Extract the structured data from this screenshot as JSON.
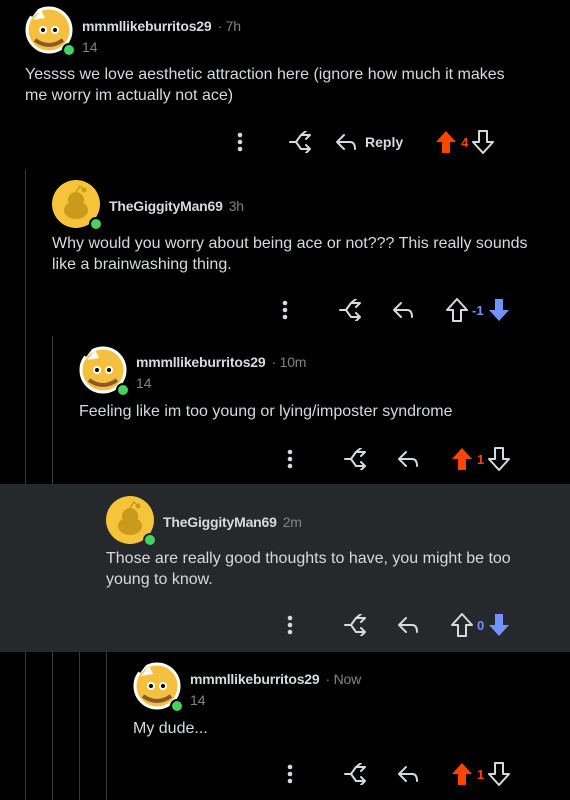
{
  "comments": [
    {
      "username": "mmmllikeburritos29",
      "time": "· 7h",
      "flair": "14",
      "body": "Yessss we love aesthetic attraction here (ignore how much it makes me worry im actually not ace)",
      "reply_label": "Reply",
      "score": "4",
      "vote_state": "up",
      "avatar_style": "burrito"
    },
    {
      "username": "TheGiggityMan69",
      "time": "3h",
      "body": "Why would you worry about being ace or not??? This really sounds like a brainwashing thing.",
      "score": "-1",
      "vote_state": "down",
      "avatar_style": "snoo-yellow"
    },
    {
      "username": "mmmllikeburritos29",
      "time": "· 10m",
      "flair": "14",
      "body": "Feeling like im too young or lying/imposter syndrome",
      "score": "1",
      "vote_state": "up",
      "avatar_style": "burrito"
    },
    {
      "username": "TheGiggityMan69",
      "time": "2m",
      "body": "Those are really good thoughts to have, you might be too young to know.",
      "score": "0",
      "vote_state": "down",
      "avatar_style": "snoo-yellow"
    },
    {
      "username": "mmmllikeburritos29",
      "time": "· Now",
      "flair": "14",
      "body": "My dude...",
      "score": "1",
      "vote_state": "up",
      "avatar_style": "burrito"
    }
  ],
  "colors": {
    "upvote": "#ff4500",
    "downvote": "#7193ff",
    "online": "#46d160",
    "highlight_bg": "#26292b"
  },
  "icons": [
    "more-vertical-icon",
    "share-icon",
    "reply-arrow-icon",
    "upvote-icon",
    "downvote-icon"
  ]
}
